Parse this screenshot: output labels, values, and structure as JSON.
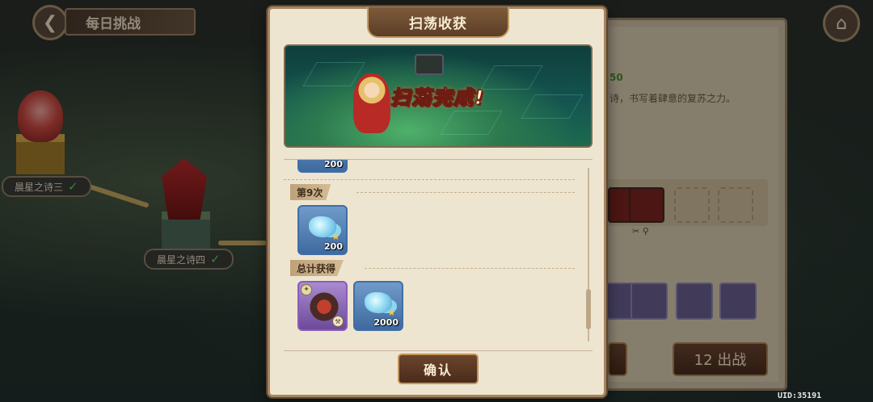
{
  "top_bar": {
    "back_icon": "back-arrow-icon",
    "title": "每日挑战",
    "home_icon": "home-icon"
  },
  "map": {
    "stages": [
      {
        "label": "晨星之诗三",
        "cleared": true
      },
      {
        "label": "晨星之诗四",
        "cleared": true
      }
    ]
  },
  "side_panel": {
    "level_fragment": "50",
    "desc_fragment": "诗，书写着肆意的复苏之力。",
    "battle_button": "12 出战"
  },
  "modal": {
    "title": "扫荡收获",
    "banner_text": "扫荡完成!",
    "partial_item_qty": "200",
    "round_label": "第9次",
    "round_items": [
      {
        "icon": "crystal-icon",
        "qty": "200"
      }
    ],
    "total_label": "总计获得",
    "total_items": [
      {
        "icon": "equipment-fragment-icon",
        "qty": ""
      },
      {
        "icon": "crystal-icon",
        "qty": "2000"
      }
    ],
    "confirm_label": "确认"
  },
  "uid_text": "UID:35191",
  "colors": {
    "modal_bg": "#eee5d1",
    "modal_border": "#a4865d",
    "button_brown": "#5a3a24",
    "rare_blue": "#3f6fa6",
    "epic_purple": "#8a5db8",
    "cleared_green": "#5bd06a"
  }
}
